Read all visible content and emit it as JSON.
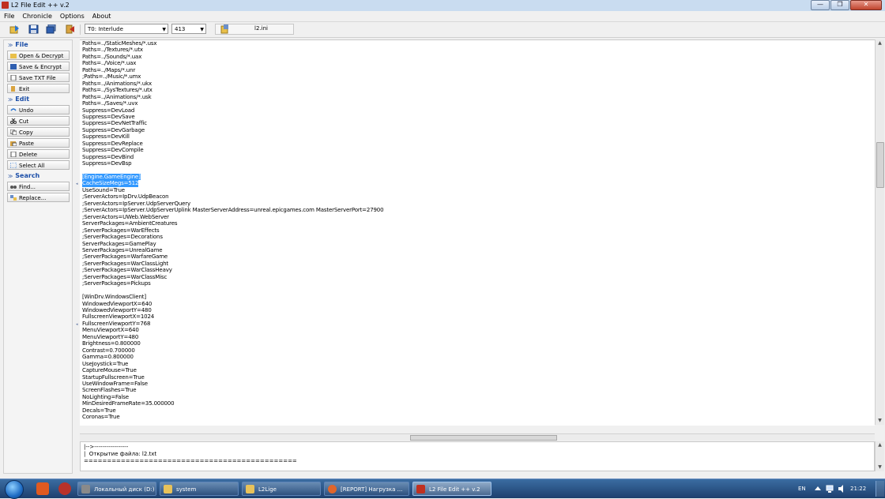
{
  "window": {
    "title": "L2 File Edit ++ v.2",
    "controls": [
      "—",
      "❐",
      "✕"
    ]
  },
  "menu": [
    "File",
    "Chronicle",
    "Options",
    "About"
  ],
  "toolbar": {
    "chronicle": "T0: Interlude",
    "protocol": "413",
    "file_name": "l2.ini"
  },
  "sidebar": {
    "file_title": "File",
    "file_items": [
      "Open & Decrypt",
      "Save & Encrypt",
      "Save TXT File",
      "Exit"
    ],
    "edit_title": "Edit",
    "edit_items": [
      "Undo",
      "Cut",
      "Copy",
      "Paste",
      "Delete",
      "Select All"
    ],
    "search_title": "Search",
    "search_items": [
      "Find...",
      "Replace..."
    ]
  },
  "editor": {
    "lines": [
      "Paths=../StaticMeshes/*.usx",
      "Paths=../Textures/*.utx",
      "Paths=../Sounds/*.uax",
      "Paths=../Voice/*.uax",
      "Paths=../Maps/*.unr",
      ";Paths=../Music/*.umx",
      "Paths=../Animations/*.ukx",
      "Paths=../SysTextures/*.utx",
      "Paths=../Animations/*.usk",
      "Paths=../Saves/*.uvx",
      "Suppress=DevLoad",
      "Suppress=DevSave",
      "Suppress=DevNetTraffic",
      "Suppress=DevGarbage",
      "Suppress=DevKill",
      "Suppress=DevReplace",
      "Suppress=DevCompile",
      "Suppress=DevBind",
      "Suppress=DevBsp",
      "",
      "[Engine.GameEngine]",
      "CacheSizeMegs=512",
      "UseSound=True",
      ";ServerActors=IpDrv.UdpBeacon",
      ";ServerActors=IpServer.UdpServerQuery",
      ";ServerActors=IpServer.UdpServerUplink MasterServerAddress=unreal.epicgames.com MasterServerPort=27900",
      ";ServerActors=UWeb.WebServer",
      "ServerPackages=AmbientCreatures",
      ";ServerPackages=WarEffects",
      ";ServerPackages=Decorations",
      "ServerPackages=GamePlay",
      "ServerPackages=UnrealGame",
      ";ServerPackages=WarfareGame",
      ";ServerPackages=WarClassLight",
      ";ServerPackages=WarClassHeavy",
      ";ServerPackages=WarClassMisc",
      ";ServerPackages=Pickups",
      "",
      "[WinDrv.WindowsClient]",
      "WindowedViewportX=640",
      "WindowedViewportY=480",
      "FullscreenViewportX=1024",
      "FullscreenViewportY=768",
      "MenuViewportX=640",
      "MenuViewportY=480",
      "Brightness=0.800000",
      "Contrast=0.700000",
      "Gamma=0.800000",
      "UseJoystick=True",
      "CaptureMouse=True",
      "StartupFullscreen=True",
      "UseWindowFrame=False",
      "ScreenFlashes=True",
      "NoLighting=False",
      "MinDesiredFrameRate=35.000000",
      "Decals=True",
      "Coronas=True"
    ],
    "selected_lines": [
      20,
      21
    ]
  },
  "log": {
    "lines": [
      "|-->-----------------",
      "|  Открытие файла: l2.txt",
      "=============================================="
    ]
  },
  "taskbar": {
    "tasks": [
      {
        "label": "Локальный диск (D:)",
        "color": "#8a8a8a"
      },
      {
        "label": "system",
        "color": "#e8c25a"
      },
      {
        "label": "L2Lige",
        "color": "#e8c25a"
      },
      {
        "label": "[REPORT] Нагрузка ...",
        "color": "#e0652a"
      },
      {
        "label": "L2 File Edit ++ v.2",
        "color": "#c03020"
      }
    ],
    "language": "EN",
    "time": "21:22"
  },
  "colors": {
    "selection": "#3399ff",
    "section_title": "#1b4ea8"
  }
}
